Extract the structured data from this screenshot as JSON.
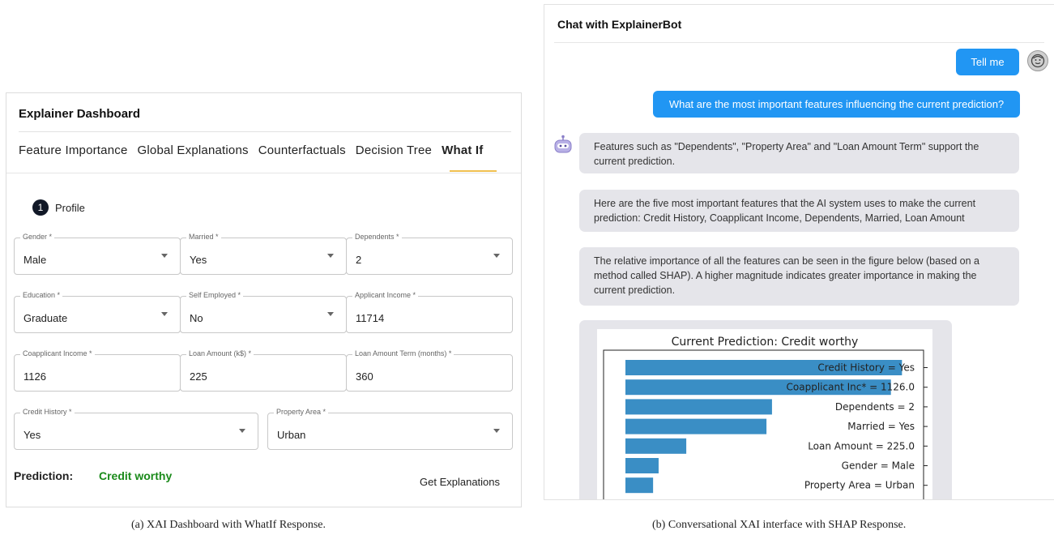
{
  "dashboard": {
    "title": "Explainer Dashboard",
    "tabs": [
      "Feature Importance",
      "Global Explanations",
      "Counterfactuals",
      "Decision Tree",
      "What If"
    ],
    "active_tab": "What If",
    "step": {
      "number": "1",
      "label": "Profile"
    },
    "fields": {
      "gender": {
        "label": "Gender *",
        "value": "Male"
      },
      "married": {
        "label": "Married *",
        "value": "Yes"
      },
      "dependents": {
        "label": "Dependents *",
        "value": "2"
      },
      "education": {
        "label": "Education *",
        "value": "Graduate"
      },
      "self_employed": {
        "label": "Self Employed *",
        "value": "No"
      },
      "applicant_income": {
        "label": "Applicant Income *",
        "value": "11714"
      },
      "coapplicant_income": {
        "label": "Coapplicant Income *",
        "value": "1126"
      },
      "loan_amount": {
        "label": "Loan Amount (k$) *",
        "value": "225"
      },
      "loan_term": {
        "label": "Loan Amount Term (months) *",
        "value": "360"
      },
      "credit_history": {
        "label": "Credit History *",
        "value": "Yes"
      },
      "property_area": {
        "label": "Property Area *",
        "value": "Urban"
      }
    },
    "prediction_label": "Prediction:",
    "prediction_value": "Credit worthy",
    "get_explanations": "Get Explanations",
    "caption": "(a)  XAI Dashboard with WhatIf Response."
  },
  "chat": {
    "title": "Chat with ExplainerBot",
    "user_msg_1": "Tell me",
    "user_msg_2": "What are the most important features influencing the current prediction?",
    "bot_msg_1": "Features such as \"Dependents\", \"Property Area\" and \"Loan Amount Term\" support the current prediction.",
    "bot_msg_2": "Here are the five most important features that the AI system uses to make the current prediction: Credit History, Coapplicant Income, Dependents, Married, Loan Amount",
    "bot_msg_3": "The relative importance of all the features can be seen in the figure below (based on a method called SHAP). A higher magnitude indicates greater importance in making the current prediction.",
    "caption": "(b)  Conversational XAI interface with SHAP Response."
  },
  "colors": {
    "accent": "#2196f3",
    "bar": "#3a8ec5",
    "prediction": "#1a8a1a",
    "tab_underline": "#f0c050"
  },
  "chart_data": {
    "type": "bar",
    "orientation": "horizontal",
    "title": "Current Prediction: Credit worthy",
    "categories": [
      "Credit History = Yes",
      "Coapplicant Inc* = 1126.0",
      "Dependents = 2",
      "Married = Yes",
      "Loan Amount = 225.0",
      "Gender = Male",
      "Property Area = Urban"
    ],
    "values": [
      1.0,
      0.96,
      0.53,
      0.51,
      0.22,
      0.12,
      0.1
    ],
    "xlim": [
      0,
      1.04
    ],
    "xlabel": "",
    "ylabel": ""
  }
}
